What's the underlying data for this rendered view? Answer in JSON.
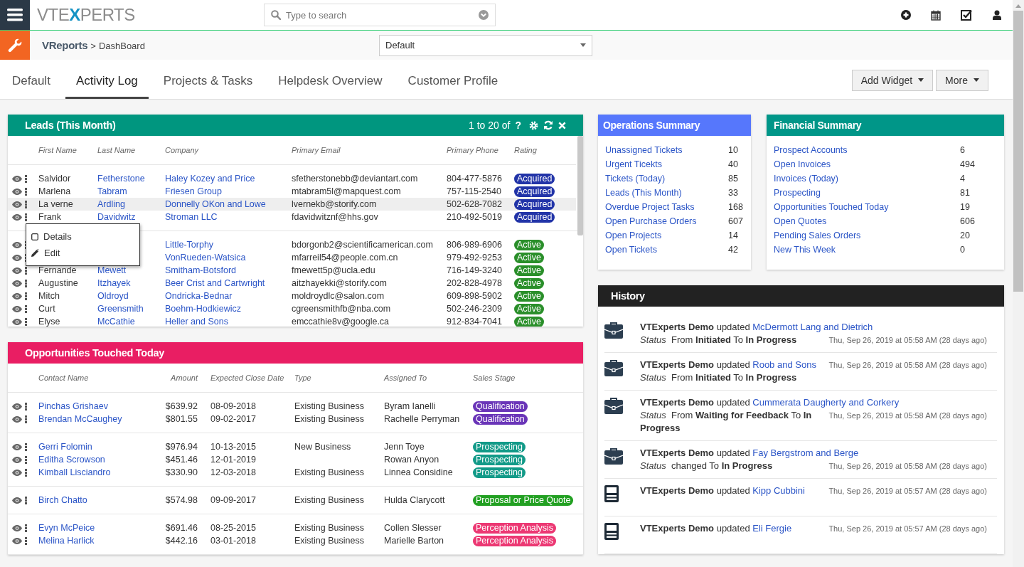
{
  "topbar": {
    "logo": [
      "VTE",
      "X",
      "PERTS"
    ],
    "search": {
      "placeholder": "Type to search"
    }
  },
  "breadcrumb": {
    "module": "VReports",
    "separator": ">",
    "page": "DashBoard"
  },
  "dashboard_select": {
    "value": "Default"
  },
  "tabs": [
    {
      "label": "Default",
      "selected": false
    },
    {
      "label": "Activity Log",
      "selected": true
    },
    {
      "label": "Projects & Tasks",
      "selected": false
    },
    {
      "label": "Helpdesk Overview",
      "selected": false
    },
    {
      "label": "Customer Profile",
      "selected": false
    }
  ],
  "actions": [
    {
      "label": "Add Widget"
    },
    {
      "label": "More"
    }
  ],
  "leads": {
    "title": "Leads (This Month)",
    "pager": "1 to 20 of",
    "pager_icon": "?",
    "columns": [
      "First Name",
      "Last Name",
      "Company",
      "Primary Email",
      "Primary Phone",
      "Rating"
    ],
    "groups": [
      {
        "rows": [
          {
            "first": "Salvidor",
            "last": "Fetherstone",
            "company": "Haley Kozey and Price",
            "email": "sfetherstonebb@deviantart.com",
            "phone": "804-477-5876",
            "rating": "Acquired",
            "color": "#2234a8",
            "highlighted": false
          },
          {
            "first": "Marlena",
            "last": "Tabram",
            "company": "Friesen Group",
            "email": "mtabram5l@mapquest.com",
            "phone": "757-115-2540",
            "rating": "Acquired",
            "color": "#2234a8",
            "highlighted": false
          },
          {
            "first": "La verne",
            "last": "Ardling",
            "company": "Donnelly OKon and Lowe",
            "email": "lvernekb@storify.com",
            "phone": "502-628-7082",
            "rating": "Acquired",
            "color": "#2234a8",
            "highlighted": true
          },
          {
            "first": "Frank",
            "last": "Davidwitz",
            "company": "Stroman LLC",
            "email": "fdavidwitznf@hhs.gov",
            "phone": "210-492-5019",
            "rating": "Acquired",
            "color": "#2234a8",
            "highlighted": false
          }
        ]
      },
      {
        "rows": [
          {
            "company": "Little-Torphy",
            "email": "bdorgonb2@scientificamerican.com",
            "phone": "806-989-6906",
            "rating": "Active",
            "color": "#2a8f2a",
            "highlighted": false
          },
          {
            "company": "VonRueden-Watsica",
            "email": "mfarreil54@people.com.cn",
            "phone": "979-492-9253",
            "rating": "Active",
            "color": "#2a8f2a",
            "highlighted": false
          },
          {
            "first": "Fernande",
            "last": "Mewett",
            "company": "Smitham-Botsford",
            "email": "fmewett5p@ucla.edu",
            "phone": "716-149-3240",
            "rating": "Active",
            "color": "#2a8f2a",
            "highlighted": false
          },
          {
            "first": "Augustine",
            "last": "Itzhayek",
            "company": "Beer Crist and Cartwright",
            "email": "aitzhayekki@storify.com",
            "phone": "202-828-4978",
            "rating": "Active",
            "color": "#2a8f2a",
            "highlighted": false
          },
          {
            "first": "Mitch",
            "last": "Oldroyd",
            "company": "Ondricka-Bednar",
            "email": "moldroydlc@salon.com",
            "phone": "609-898-5902",
            "rating": "Active",
            "color": "#2a8f2a",
            "highlighted": false
          },
          {
            "first": "Curt",
            "last": "Greensmith",
            "company": "Boehm-Hodkiewicz",
            "email": "cgreensmithfb@nba.com",
            "phone": "502-246-2309",
            "rating": "Active",
            "color": "#2a8f2a",
            "highlighted": false
          },
          {
            "first": "Elyse",
            "last": "McCathie",
            "company": "Heller and Sons",
            "email": "emccathie8v@google.ca",
            "phone": "912-834-7041",
            "rating": "Active",
            "color": "#2a8f2a",
            "highlighted": false
          }
        ]
      }
    ]
  },
  "context_menu": {
    "items": [
      {
        "kind": "details",
        "label": "Details"
      },
      {
        "kind": "edit",
        "label": "Edit"
      }
    ]
  },
  "opportunities": {
    "title": "Opportunities Touched Today",
    "columns": [
      "Contact Name",
      "Amount",
      "Expected Close Date",
      "Type",
      "Assigned To",
      "Sales Stage"
    ],
    "groups": [
      {
        "rows": [
          {
            "contact": "Pinchas Grishaev",
            "amount": "$639.92",
            "close_date": "08-09-2018",
            "type": "Existing Business",
            "assigned": "Byram Ianelli",
            "stage": "Qualification",
            "color": "#6a35b8"
          },
          {
            "contact": "Brendan McCaughey",
            "amount": "$801.55",
            "close_date": "09-02-2017",
            "type": "Existing Business",
            "assigned": "Rachelle Perryman",
            "stage": "Qualification",
            "color": "#6a35b8"
          }
        ]
      },
      {
        "rows": [
          {
            "contact": "Gerri Folomin",
            "amount": "$976.94",
            "close_date": "10-13-2015",
            "type": "New Business",
            "assigned": "Jenn Toye",
            "stage": "Prospecting",
            "color": "#129a88"
          },
          {
            "contact": "Editha Scrowson",
            "amount": "$451.46",
            "close_date": "12-01-2019",
            "assigned": "Rowan Anyon",
            "stage": "Prospecting",
            "color": "#129a88"
          },
          {
            "contact": "Kimball Lisciandro",
            "amount": "$330.90",
            "close_date": "12-03-2018",
            "type": "Existing Business",
            "assigned": "Linnea Considine",
            "stage": "Prospecting",
            "color": "#129a88"
          }
        ]
      },
      {
        "rows": [
          {
            "contact": "Birch Chatto",
            "amount": "$574.98",
            "close_date": "09-09-2017",
            "type": "Existing Business",
            "assigned": "Hulda Clarycott",
            "stage": "Proposal or Price Quote",
            "color": "#22a022"
          }
        ]
      },
      {
        "rows": [
          {
            "contact": "Evyn McPeice",
            "amount": "$691.46",
            "close_date": "08-25-2015",
            "type": "Existing Business",
            "assigned": "Collen Slesser",
            "stage": "Perception Analysis",
            "color": "#ec3873"
          },
          {
            "contact": "Melina Harlick",
            "amount": "$442.16",
            "close_date": "03-01-2018",
            "type": "Existing Business",
            "assigned": "Marielle Barton",
            "stage": "Perception Analysis",
            "color": "#ec3873"
          }
        ]
      }
    ]
  },
  "operations_summary": {
    "title": "Operations Summary",
    "rows": [
      {
        "label": "Unassigned Tickets",
        "value": "10"
      },
      {
        "label": "Urgent Ticekts",
        "value": "40"
      },
      {
        "label": "Tickets (Today)",
        "value": "85"
      },
      {
        "label": "Leads (This Month)",
        "value": "33"
      },
      {
        "label": "Overdue Project Tasks",
        "value": "168"
      },
      {
        "label": "Open Purchase Orders",
        "value": "607"
      },
      {
        "label": "Open Projects",
        "value": "14"
      },
      {
        "label": "Open Tickets",
        "value": "42"
      }
    ]
  },
  "financial_summary": {
    "title": "Financial Summary",
    "rows": [
      {
        "label": "Prospect Accounts",
        "value": "6"
      },
      {
        "label": "Open Invoices",
        "value": "494"
      },
      {
        "label": "Invoices (Today)",
        "value": "4"
      },
      {
        "label": "Prospecting",
        "value": "81"
      },
      {
        "label": "Opportunities Touched Today",
        "value": "19"
      },
      {
        "label": "Open Quotes",
        "value": "606"
      },
      {
        "label": "Pending Sales Orders",
        "value": "20"
      },
      {
        "label": "New This Week",
        "value": "0"
      }
    ]
  },
  "history": {
    "title": "History",
    "items": [
      {
        "kind": "project",
        "actor": "VTExperts Demo",
        "action": "updated",
        "target": "McDermott Lang and Dietrich",
        "field": "Status",
        "change": "From **Initiated** To **In Progress**",
        "time": "Thu, Sep 26, 2019 at 05:58 AM (28 days ago)"
      },
      {
        "kind": "project",
        "actor": "VTExperts Demo",
        "action": "updated",
        "target": "Roob and Sons",
        "field": "Status",
        "change": "From **Initiated** To **In Progress**",
        "time": "Thu, Sep 26, 2019 at 05:58 AM (28 days ago)"
      },
      {
        "kind": "project",
        "actor": "VTExperts Demo",
        "action": "updated",
        "target": "Cummerata Daugherty and Corkery",
        "field": "Status",
        "change": "From **Waiting for Feedback** To **In Progress**",
        "time": "Thu, Sep 26, 2019 at 05:58 AM (28 days ago)"
      },
      {
        "kind": "project",
        "actor": "VTExperts Demo",
        "action": "updated",
        "target": "Fay Bergstrom and Berge",
        "field": "Status",
        "change": "changed To **In Progress**",
        "time": "Thu, Sep 26, 2019 at 05:58 AM (28 days ago)"
      },
      {
        "kind": "order",
        "actor": "VTExperts Demo",
        "action": "updated",
        "target": "Kipp Cubbini",
        "time": "Thu, Sep 26, 2019 at 05:57 AM (28 days ago)"
      },
      {
        "kind": "order",
        "actor": "VTExperts Demo",
        "action": "updated",
        "target": "Eli Fergie",
        "time": "Thu, Sep 26, 2019 at 05:57 AM (28 days ago)"
      }
    ]
  }
}
